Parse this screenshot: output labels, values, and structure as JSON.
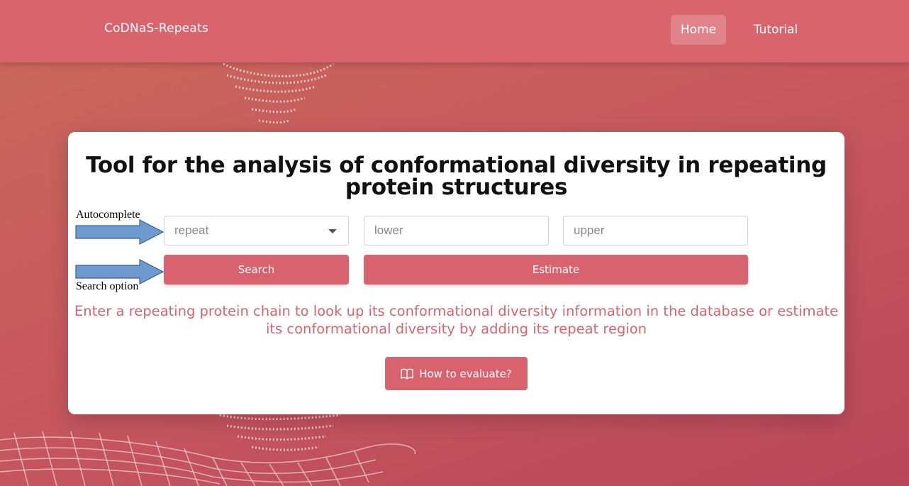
{
  "navbar": {
    "brand": "CoDNaS-Repeats",
    "links": [
      {
        "label": "Home",
        "active": true
      },
      {
        "label": "Tutorial",
        "active": false
      }
    ]
  },
  "main": {
    "title": "Tool for the analysis of conformational diversity in repeating protein structures",
    "annotations": {
      "autocomplete": "Autocomplete",
      "search_option": "Search option"
    },
    "repeat_select": {
      "placeholder": "repeat",
      "icon": "chevron-down-icon"
    },
    "lower_input": {
      "placeholder": "lower"
    },
    "upper_input": {
      "placeholder": "upper"
    },
    "search_button": "Search",
    "estimate_button": "Estimate",
    "description": "Enter a repeating protein chain to look up its conformational diversity information in the database or estimate its conformational diversity by adding its repeat region",
    "how_to_button": {
      "label": "How to evaluate?",
      "icon": "book-icon"
    }
  },
  "colors": {
    "accent": "#d9646e",
    "button": "#d8626d",
    "arrow_fill": "#6f9ad0",
    "arrow_stroke": "#3a5f8f"
  }
}
